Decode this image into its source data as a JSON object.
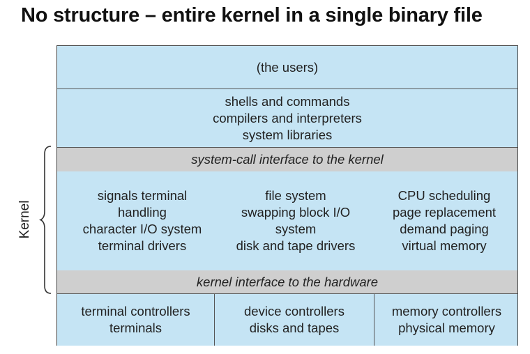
{
  "title": "No structure – entire kernel in a single binary file",
  "layers": {
    "users": "(the users)",
    "applications": [
      "shells and commands",
      "compilers and interpreters",
      "system libraries"
    ],
    "syscall_interface": "system-call interface to the kernel",
    "kernel_columns": [
      [
        "signals terminal",
        "handling",
        "character I/O system",
        "terminal drivers"
      ],
      [
        "file system",
        "swapping block I/O",
        "system",
        "disk and tape drivers"
      ],
      [
        "CPU scheduling",
        "page replacement",
        "demand paging",
        "virtual memory"
      ]
    ],
    "hardware_interface": "kernel interface to the hardware",
    "controllers": [
      [
        "terminal controllers",
        "terminals"
      ],
      [
        "device controllers",
        "disks and tapes"
      ],
      [
        "memory controllers",
        "physical memory"
      ]
    ]
  },
  "kernel_label": "Kernel",
  "colors": {
    "blue_band": "#c5e4f4",
    "gray_band": "#cfcfcf",
    "border": "#444444"
  }
}
